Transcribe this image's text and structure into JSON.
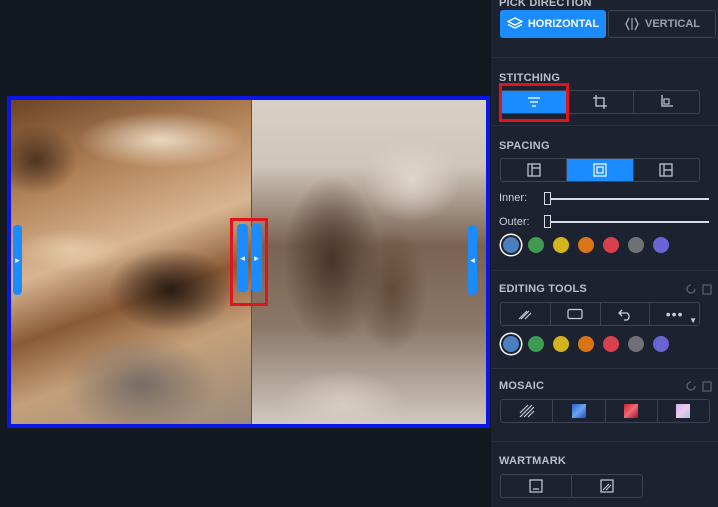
{
  "panel": {
    "pick_direction": {
      "title": "PICK DIRECTION",
      "options": [
        {
          "label": "HORIZONTAL",
          "icon": "layers-icon",
          "selected": true
        },
        {
          "label": "VERTICAL",
          "icon": "vertical-stitch-icon",
          "selected": false
        }
      ]
    },
    "stitching": {
      "title": "STITCHING",
      "options": [
        {
          "icon": "align-center-icon",
          "selected": true
        },
        {
          "icon": "crop-icon",
          "selected": false
        },
        {
          "icon": "crop-alt-icon",
          "selected": false
        }
      ]
    },
    "spacing": {
      "title": "SPACING",
      "layouts": [
        {
          "icon": "layout-left-icon",
          "selected": false
        },
        {
          "icon": "layout-center-icon",
          "selected": true
        },
        {
          "icon": "layout-right-icon",
          "selected": false
        }
      ],
      "inner_label": "Inner:",
      "outer_label": "Outer:",
      "inner_value": 0,
      "outer_value": 0,
      "colors": [
        "#4a7fc1",
        "#3f9b52",
        "#d4b41c",
        "#d97515",
        "#d7414c",
        "#6f7275",
        "#6a63d6"
      ],
      "selected_color_index": 0
    },
    "editing_tools": {
      "title": "EDITING TOOLS",
      "tools": [
        "pen-icon",
        "rectangle-icon",
        "undo-icon",
        "more-icon"
      ],
      "colors": [
        "#4a7fc1",
        "#3f9b52",
        "#d4b41c",
        "#d97515",
        "#d7414c",
        "#6f7275",
        "#6a63d6"
      ],
      "selected_color_index": 0
    },
    "mosaic": {
      "title": "MOSAIC",
      "patterns": [
        "stripes-pattern-icon",
        "blue-mosaic-icon",
        "red-mosaic-icon",
        "pastel-mosaic-icon"
      ]
    },
    "watermark": {
      "title": "WARTMARK",
      "tools": [
        "text-watermark-icon",
        "image-watermark-icon"
      ]
    }
  },
  "accent": "#1a8cff",
  "highlight": "#e0141c",
  "frame_border": "#0a16e6"
}
